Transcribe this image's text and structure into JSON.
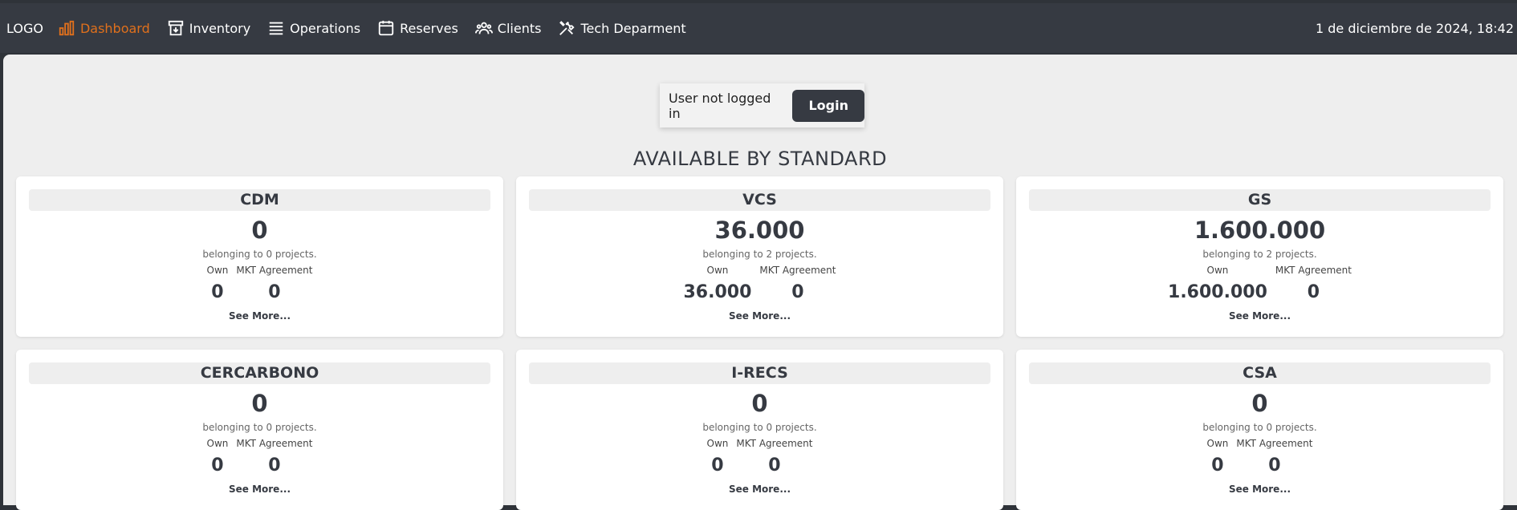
{
  "nav": {
    "logo": "LOGO",
    "items": [
      {
        "label": "Dashboard",
        "icon": "bar-chart-icon"
      },
      {
        "label": "Inventory",
        "icon": "archive-icon"
      },
      {
        "label": "Operations",
        "icon": "list-icon"
      },
      {
        "label": "Reserves",
        "icon": "calendar-icon"
      },
      {
        "label": "Clients",
        "icon": "users-icon"
      },
      {
        "label": "Tech Deparment",
        "icon": "tools-icon"
      }
    ],
    "datetime": "1 de diciembre de 2024, 18:42"
  },
  "login": {
    "status": "User not logged in",
    "button": "Login"
  },
  "section_title": "AVAILABLE BY STANDARD",
  "cards": [
    {
      "name": "CDM",
      "total": "0",
      "projects": "belonging to 0 projects.",
      "own_label": "Own",
      "mkt_label": "MKT Agreement",
      "own": "0",
      "mkt": "0",
      "see_more": "See More..."
    },
    {
      "name": "VCS",
      "total": "36.000",
      "projects": "belonging to 2 projects.",
      "own_label": "Own",
      "mkt_label": "MKT Agreement",
      "own": "36.000",
      "mkt": "0",
      "see_more": "See More..."
    },
    {
      "name": "GS",
      "total": "1.600.000",
      "projects": "belonging to 2 projects.",
      "own_label": "Own",
      "mkt_label": "MKT Agreement",
      "own": "1.600.000",
      "mkt": "0",
      "see_more": "See More..."
    },
    {
      "name": "CERCARBONO",
      "total": "0",
      "projects": "belonging to 0 projects.",
      "own_label": "Own",
      "mkt_label": "MKT Agreement",
      "own": "0",
      "mkt": "0",
      "see_more": "See More..."
    },
    {
      "name": "I-RECS",
      "total": "0",
      "projects": "belonging to 0 projects.",
      "own_label": "Own",
      "mkt_label": "MKT Agreement",
      "own": "0",
      "mkt": "0",
      "see_more": "See More..."
    },
    {
      "name": "CSA",
      "total": "0",
      "projects": "belonging to 0 projects.",
      "own_label": "Own",
      "mkt_label": "MKT Agreement",
      "own": "0",
      "mkt": "0",
      "see_more": "See More..."
    }
  ],
  "colors": {
    "nav_bg": "#363a42",
    "active": "#e0701c",
    "page_bg": "#eeeeee"
  }
}
